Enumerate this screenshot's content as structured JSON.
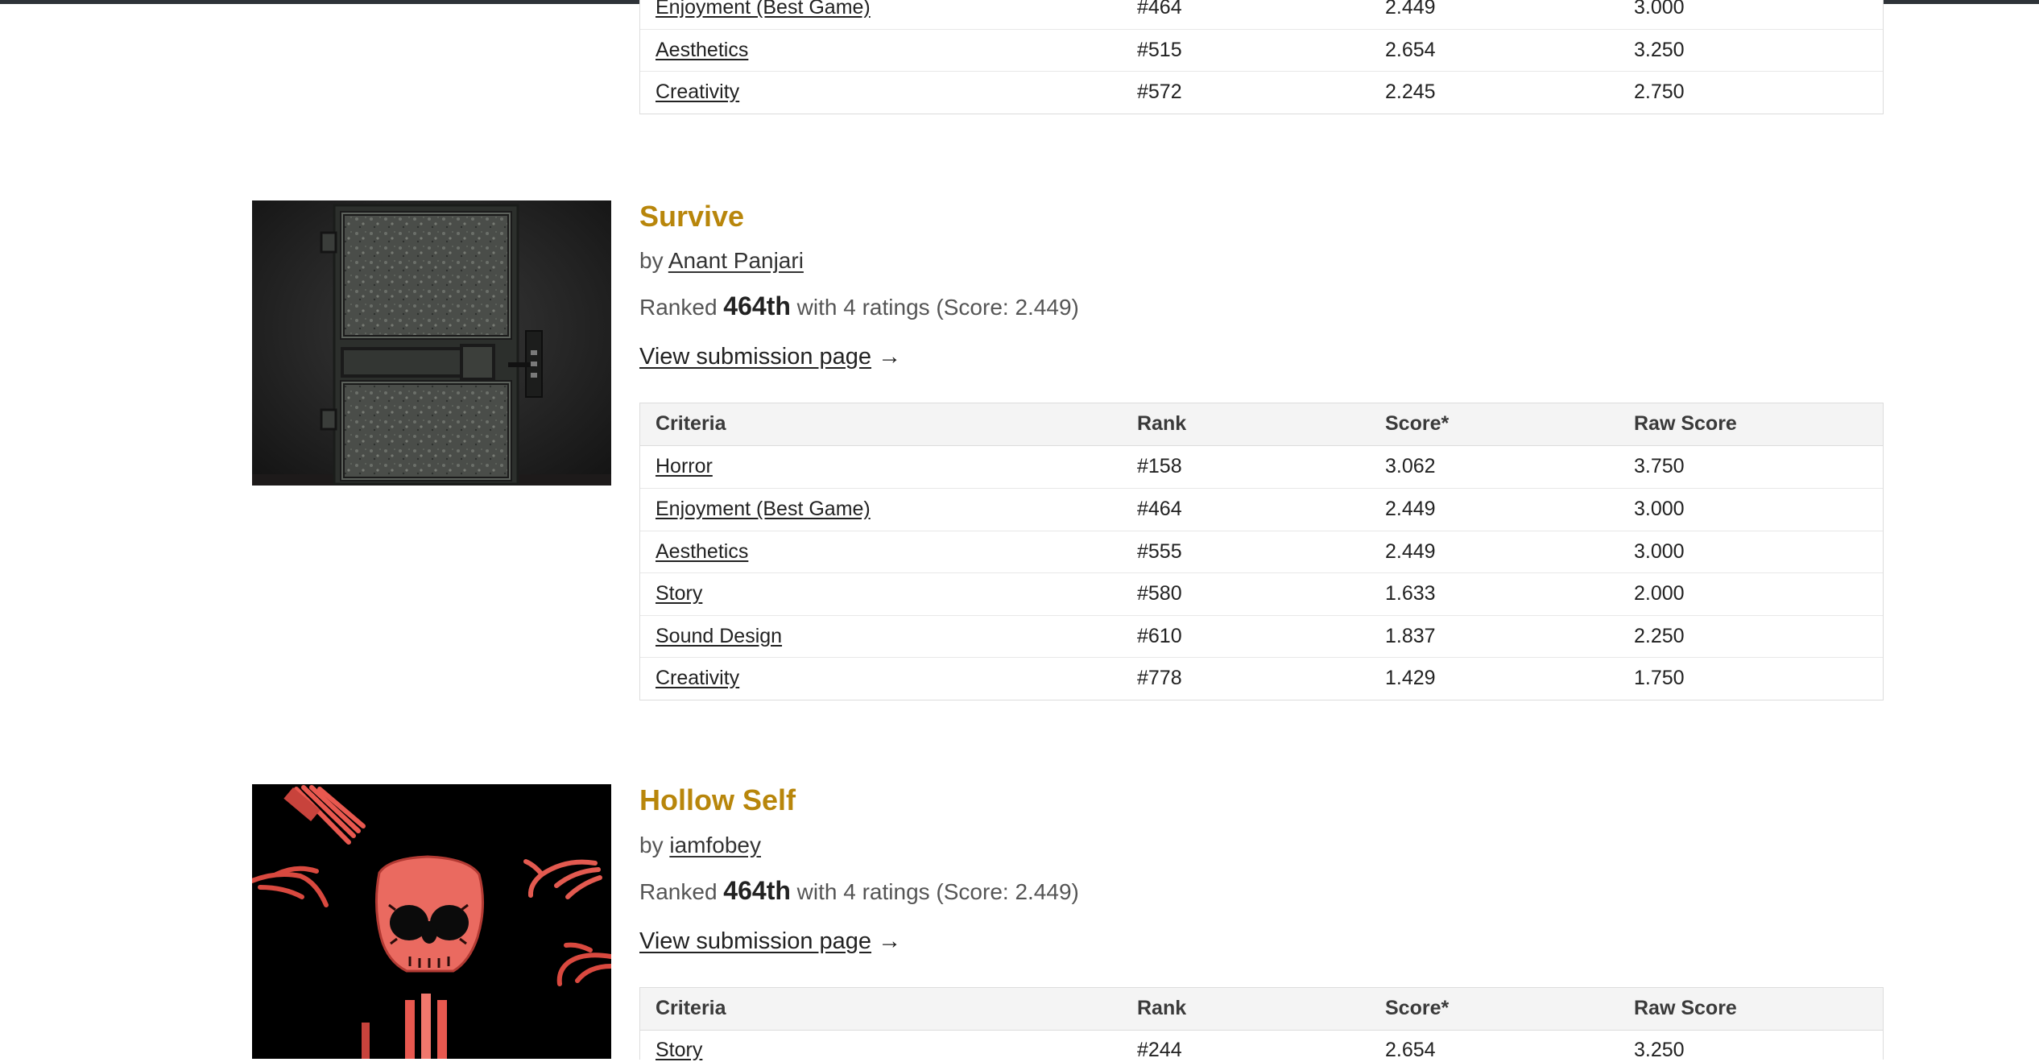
{
  "top_table": {
    "rows": [
      {
        "criteria": "Enjoyment (Best Game)",
        "rank": "#464",
        "score": "2.449",
        "raw_score": "3.000"
      },
      {
        "criteria": "Aesthetics",
        "rank": "#515",
        "score": "2.654",
        "raw_score": "3.250"
      },
      {
        "criteria": "Creativity",
        "rank": "#572",
        "score": "2.245",
        "raw_score": "2.750"
      }
    ]
  },
  "entries": [
    {
      "title": "Survive",
      "by_prefix": "by",
      "author": "Anant Panjari",
      "ranked_prefix": "Ranked",
      "rank_text": "464th",
      "ranked_suffix": "with 4 ratings (Score: 2.449)",
      "view_link": "View submission page",
      "arrow": "→",
      "table": {
        "headers": {
          "criteria": "Criteria",
          "rank": "Rank",
          "score": "Score*",
          "raw_score": "Raw Score"
        },
        "rows": [
          {
            "criteria": "Horror",
            "rank": "#158",
            "score": "3.062",
            "raw_score": "3.750"
          },
          {
            "criteria": "Enjoyment (Best Game)",
            "rank": "#464",
            "score": "2.449",
            "raw_score": "3.000"
          },
          {
            "criteria": "Aesthetics",
            "rank": "#555",
            "score": "2.449",
            "raw_score": "3.000"
          },
          {
            "criteria": "Story",
            "rank": "#580",
            "score": "1.633",
            "raw_score": "2.000"
          },
          {
            "criteria": "Sound Design",
            "rank": "#610",
            "score": "1.837",
            "raw_score": "2.250"
          },
          {
            "criteria": "Creativity",
            "rank": "#778",
            "score": "1.429",
            "raw_score": "1.750"
          }
        ]
      }
    },
    {
      "title": "Hollow Self",
      "by_prefix": "by",
      "author": "iamfobey",
      "ranked_prefix": "Ranked",
      "rank_text": "464th",
      "ranked_suffix": "with 4 ratings (Score: 2.449)",
      "view_link": "View submission page",
      "arrow": "→",
      "table": {
        "headers": {
          "criteria": "Criteria",
          "rank": "Rank",
          "score": "Score*",
          "raw_score": "Raw Score"
        },
        "rows": [
          {
            "criteria": "Story",
            "rank": "#244",
            "score": "2.654",
            "raw_score": "3.250"
          }
        ]
      }
    }
  ],
  "colors": {
    "title": "#b8860b",
    "text": "#222222",
    "muted": "#555555",
    "header_bg": "#f4f4f4",
    "border": "#dcdcdc"
  },
  "icons": {
    "survive_thumbnail": "door-thumbnail",
    "hollow_self_thumbnail": "skull-thumbnail"
  }
}
